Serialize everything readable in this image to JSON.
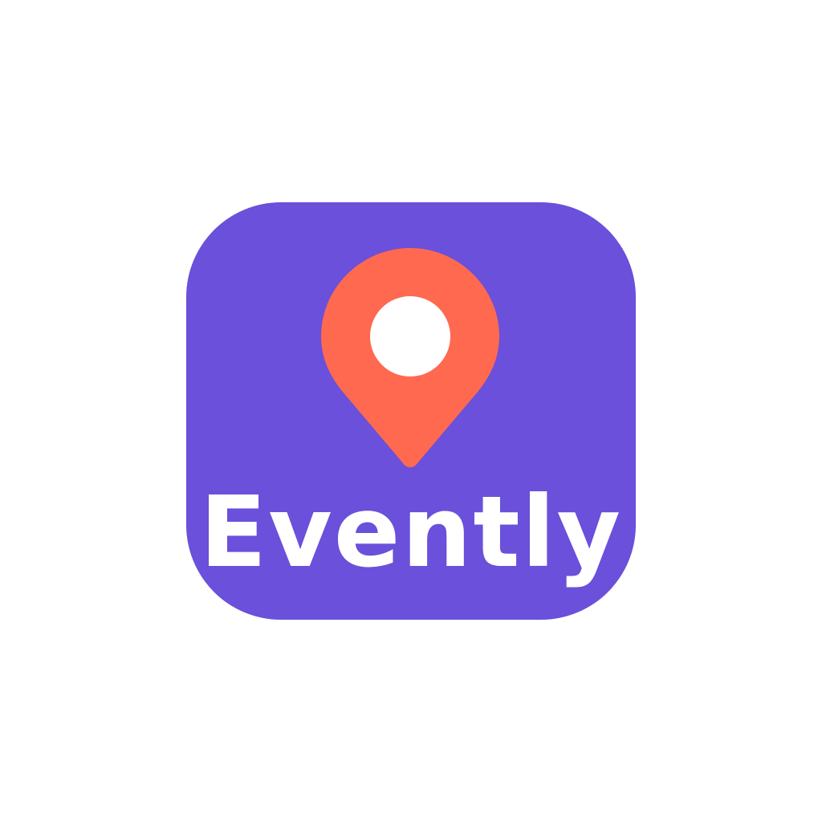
{
  "logo": {
    "wordmark": "Evently",
    "icon": "map-pin-icon",
    "colors": {
      "tile_background": "#6a50da",
      "pin": "#ff6950",
      "pin_hole": "#ffffff",
      "wordmark": "#ffffff",
      "page_background": "#ffffff"
    }
  }
}
